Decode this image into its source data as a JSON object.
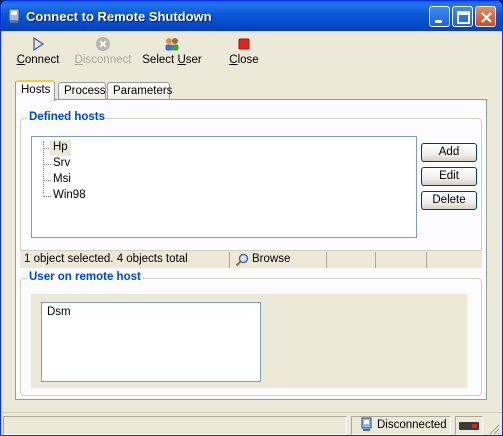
{
  "window": {
    "title": "Connect to Remote Shutdown"
  },
  "toolbar": {
    "connect": {
      "pre": "",
      "key": "C",
      "post": "onnect"
    },
    "disconnect": {
      "pre": "",
      "key": "D",
      "post": "isconnect"
    },
    "select_user": {
      "pre": "Select ",
      "key": "U",
      "post": "ser"
    },
    "close": {
      "pre": "",
      "key": "C",
      "post": "lose"
    }
  },
  "tabs": [
    "Hosts",
    "Process",
    "Parameters"
  ],
  "hosts": {
    "group_title": "Defined hosts",
    "items": [
      "Hp",
      "Srv",
      "Msi",
      "Win98"
    ],
    "selected": "Hp",
    "buttons": {
      "add": "Add",
      "edit": "Edit",
      "delete": "Delete"
    },
    "status": {
      "selection": "1 object selected.  4 objects total",
      "browse": "Browse"
    }
  },
  "user": {
    "group_title": "User on remote host",
    "value": "Dsm"
  },
  "statusbar": {
    "connection": "Disconnected"
  }
}
